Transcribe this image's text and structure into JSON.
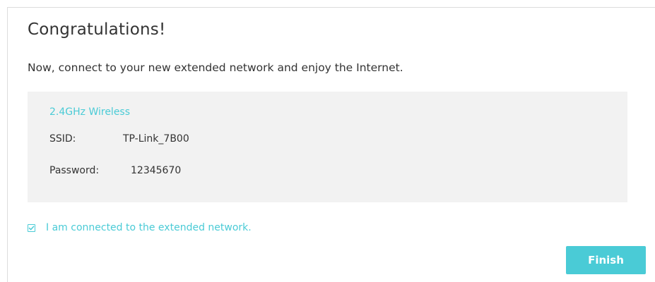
{
  "page": {
    "title": "Congratulations!",
    "subtitle": "Now, connect to your new extended network and enjoy the Internet."
  },
  "network": {
    "band_label": "2.4GHz Wireless",
    "ssid_label": "SSID:",
    "ssid_value": "TP-Link_7B00",
    "password_label": "Password:",
    "password_value": "12345670"
  },
  "confirm": {
    "label": "I am connected to the extended network.",
    "checked": true
  },
  "actions": {
    "finish_label": "Finish"
  },
  "colors": {
    "accent": "#4acbd6",
    "box_background": "#f2f2f2",
    "text": "#333333"
  }
}
